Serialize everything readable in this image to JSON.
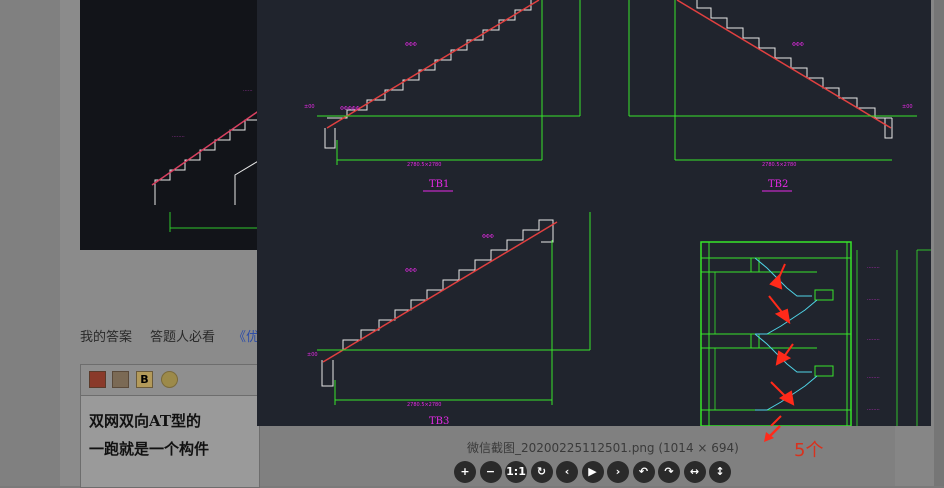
{
  "answer_tabs": {
    "my_answer": "我的答案",
    "must_read": "答题人必看",
    "link_fragment": "《优"
  },
  "editor": {
    "toolbar": {
      "bold_label": "B"
    },
    "line1": "双网双向AT型的",
    "line2": "一跑就是一个构件"
  },
  "viewer": {
    "caption": "微信截图_20200225112501.png (1014 × 694)",
    "drawing_labels": {
      "tb1": "TB1",
      "tb2": "TB2",
      "tb3": "TB3"
    },
    "annotation": "5个",
    "controls": [
      {
        "name": "zoom-in",
        "glyph": "+"
      },
      {
        "name": "zoom-out",
        "glyph": "−"
      },
      {
        "name": "actual-size",
        "glyph": "1:1"
      },
      {
        "name": "rotate",
        "glyph": "↻"
      },
      {
        "name": "previous",
        "glyph": "‹"
      },
      {
        "name": "play",
        "glyph": "▶"
      },
      {
        "name": "next",
        "glyph": "›"
      },
      {
        "name": "undo",
        "glyph": "↶"
      },
      {
        "name": "redo",
        "glyph": "↷"
      },
      {
        "name": "flip-horizontal",
        "glyph": "↔"
      },
      {
        "name": "flip-vertical",
        "glyph": "↕"
      }
    ]
  },
  "colors": {
    "cad_green": "#37e52a",
    "cad_magenta": "#e62ae6",
    "cad_white": "#e8e8e8",
    "cad_red": "#e04040",
    "arrow_red": "#ff2a1a",
    "cyan": "#4fd3e6"
  }
}
